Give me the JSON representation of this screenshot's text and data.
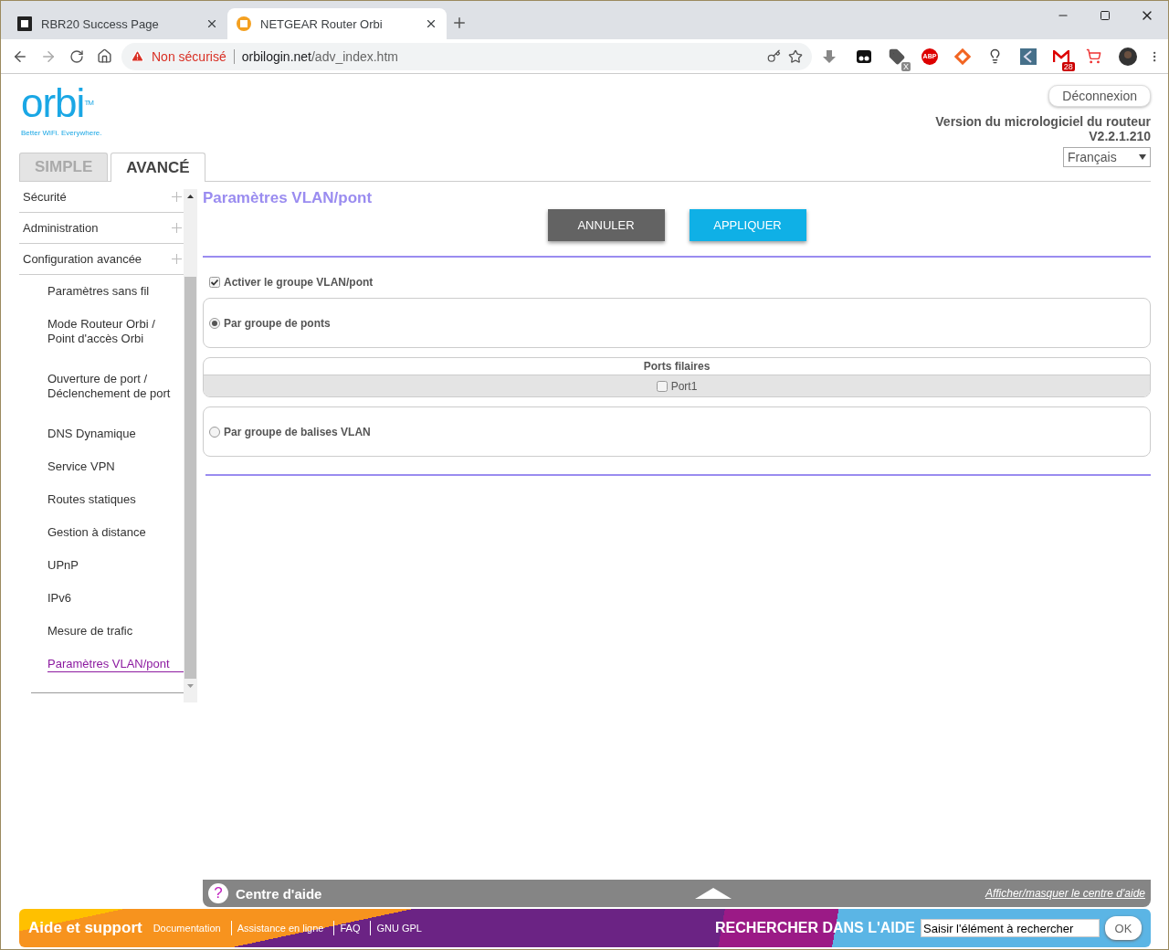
{
  "browser": {
    "tabs": [
      {
        "title": "RBR20 Success Page",
        "selected": false
      },
      {
        "title": "NETGEAR Router Orbi",
        "selected": true
      }
    ],
    "security": "Non sécurisé",
    "url_host": "orbilogin.net",
    "url_path": "/adv_index.htm",
    "mail_badge": "28",
    "tag_badge": "X",
    "abp": "ABP"
  },
  "header": {
    "logo": "orbi",
    "trademark": "TM",
    "tagline": "Better WiFi. Everywhere.",
    "logout": "Déconnexion",
    "firmware_label": "Version du micrologiciel du routeur",
    "firmware_version": "V2.2.1.210",
    "language": "Français"
  },
  "mode_tabs": [
    {
      "label": "SIMPLE",
      "selected": false
    },
    {
      "label": "AVANCÉ",
      "selected": true
    }
  ],
  "sidebar": {
    "sections": [
      {
        "label": "Sécurité"
      },
      {
        "label": "Administration"
      },
      {
        "label": "Configuration avancée"
      }
    ],
    "items": [
      {
        "lines": [
          "Paramètres sans fil"
        ],
        "selected": false
      },
      {
        "lines": [
          "Mode Routeur Orbi /",
          "Point d'accès Orbi"
        ],
        "selected": false
      },
      {
        "lines": [
          "Ouverture de port /",
          "Déclenchement de port"
        ],
        "selected": false
      },
      {
        "lines": [
          "DNS Dynamique"
        ],
        "selected": false
      },
      {
        "lines": [
          "Service VPN"
        ],
        "selected": false
      },
      {
        "lines": [
          "Routes statiques"
        ],
        "selected": false
      },
      {
        "lines": [
          "Gestion à distance"
        ],
        "selected": false
      },
      {
        "lines": [
          "UPnP"
        ],
        "selected": false
      },
      {
        "lines": [
          "IPv6"
        ],
        "selected": false
      },
      {
        "lines": [
          "Mesure de trafic"
        ],
        "selected": false
      },
      {
        "lines": [
          "Paramètres VLAN/pont"
        ],
        "selected": true
      }
    ]
  },
  "page": {
    "title": "Paramètres VLAN/pont",
    "buttons": [
      {
        "label": "ANNULER",
        "kind": "cancel"
      },
      {
        "label": "APPLIQUER",
        "kind": "apply"
      }
    ],
    "enable": {
      "label": "Activer le groupe VLAN/pont",
      "checked": true
    },
    "modes": [
      {
        "label": "Par groupe de ponts",
        "selected": true
      },
      {
        "label": "Par groupe de balises VLAN",
        "selected": false
      }
    ],
    "ports_table": {
      "header": "Ports filaires",
      "ports": [
        {
          "label": "Port1",
          "checked": false
        }
      ]
    }
  },
  "help_bar": {
    "title": "Centre d'aide",
    "icon": "?",
    "toggle": "Afficher/masquer le centre d'aide"
  },
  "footer": {
    "title": "Aide et support",
    "links": [
      "Documentation",
      "Assistance en ligne",
      "FAQ",
      "GNU GPL"
    ],
    "search_label": "RECHERCHER DANS L'AIDE",
    "search_value": "Saisir l'élément à rechercher",
    "ok": "OK"
  }
}
